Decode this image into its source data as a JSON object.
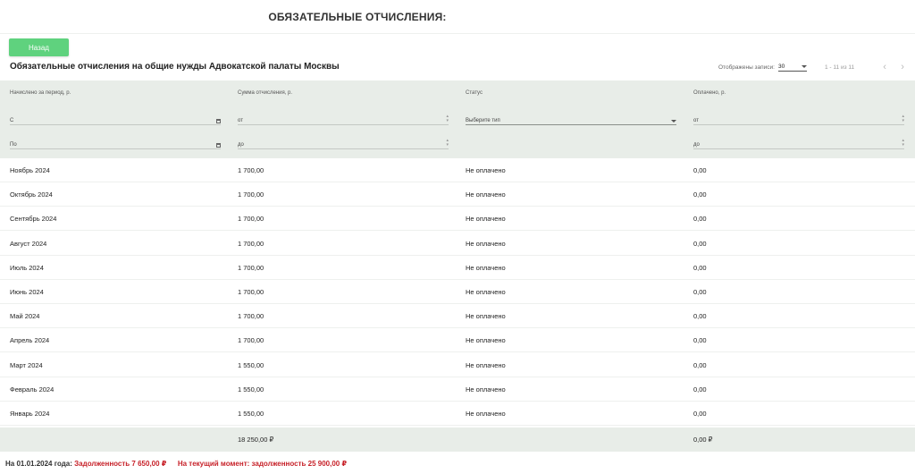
{
  "page": {
    "title": "ОБЯЗАТЕЛЬНЫЕ ОТЧИСЛЕНИЯ:"
  },
  "toolbar": {
    "back_label": "Назад"
  },
  "table": {
    "title": "Обязательные отчисления на общие нужды Адвокатской палаты Москвы",
    "columns": [
      "Начислено за период, р.",
      "Сумма отчисления, р.",
      "Статус",
      "Оплачено, р."
    ],
    "filters": {
      "period_from": "С",
      "period_to": "По",
      "amount_from": "от",
      "amount_to": "до",
      "status_placeholder": "Выберите тип",
      "paid_from": "от",
      "paid_to": "до"
    },
    "rows": [
      {
        "period": "Ноябрь 2024",
        "amount": "1 700,00",
        "status": "Не оплачено",
        "paid": "0,00"
      },
      {
        "period": "Октябрь 2024",
        "amount": "1 700,00",
        "status": "Не оплачено",
        "paid": "0,00"
      },
      {
        "period": "Сентябрь 2024",
        "amount": "1 700,00",
        "status": "Не оплачено",
        "paid": "0,00"
      },
      {
        "period": "Август 2024",
        "amount": "1 700,00",
        "status": "Не оплачено",
        "paid": "0,00"
      },
      {
        "period": "Июль 2024",
        "amount": "1 700,00",
        "status": "Не оплачено",
        "paid": "0,00"
      },
      {
        "period": "Июнь 2024",
        "amount": "1 700,00",
        "status": "Не оплачено",
        "paid": "0,00"
      },
      {
        "period": "Май 2024",
        "amount": "1 700,00",
        "status": "Не оплачено",
        "paid": "0,00"
      },
      {
        "period": "Апрель 2024",
        "amount": "1 700,00",
        "status": "Не оплачено",
        "paid": "0,00"
      },
      {
        "period": "Март 2024",
        "amount": "1 550,00",
        "status": "Не оплачено",
        "paid": "0,00"
      },
      {
        "period": "Февраль 2024",
        "amount": "1 550,00",
        "status": "Не оплачено",
        "paid": "0,00"
      },
      {
        "period": "Январь 2024",
        "amount": "1 550,00",
        "status": "Не оплачено",
        "paid": "0,00"
      }
    ],
    "totals": {
      "amount": "18 250,00 ₽",
      "paid": "0,00 ₽"
    }
  },
  "pager": {
    "rows_label": "Отображены записи:",
    "rows_value": "30",
    "range": "1 - 11 из 11",
    "prev_glyph": "‹",
    "next_glyph": "›"
  },
  "footer": {
    "date_label": "На 01.01.2024 года:",
    "debt_start": "Задолженность 7 650,00 ₽",
    "current_debt": "На текущий момент: задолженность 25 900,00 ₽"
  },
  "colors": {
    "accent_green": "#5fd27e",
    "header_bg": "#e8ede8",
    "debt_red": "#c7222a"
  },
  "icons": {
    "date_picker": "calendar-icon",
    "number_spinner": "spinner-icon",
    "dropdown": "chevron-down-icon",
    "pager_prev": "chevron-left-icon",
    "pager_next": "chevron-right-icon"
  }
}
